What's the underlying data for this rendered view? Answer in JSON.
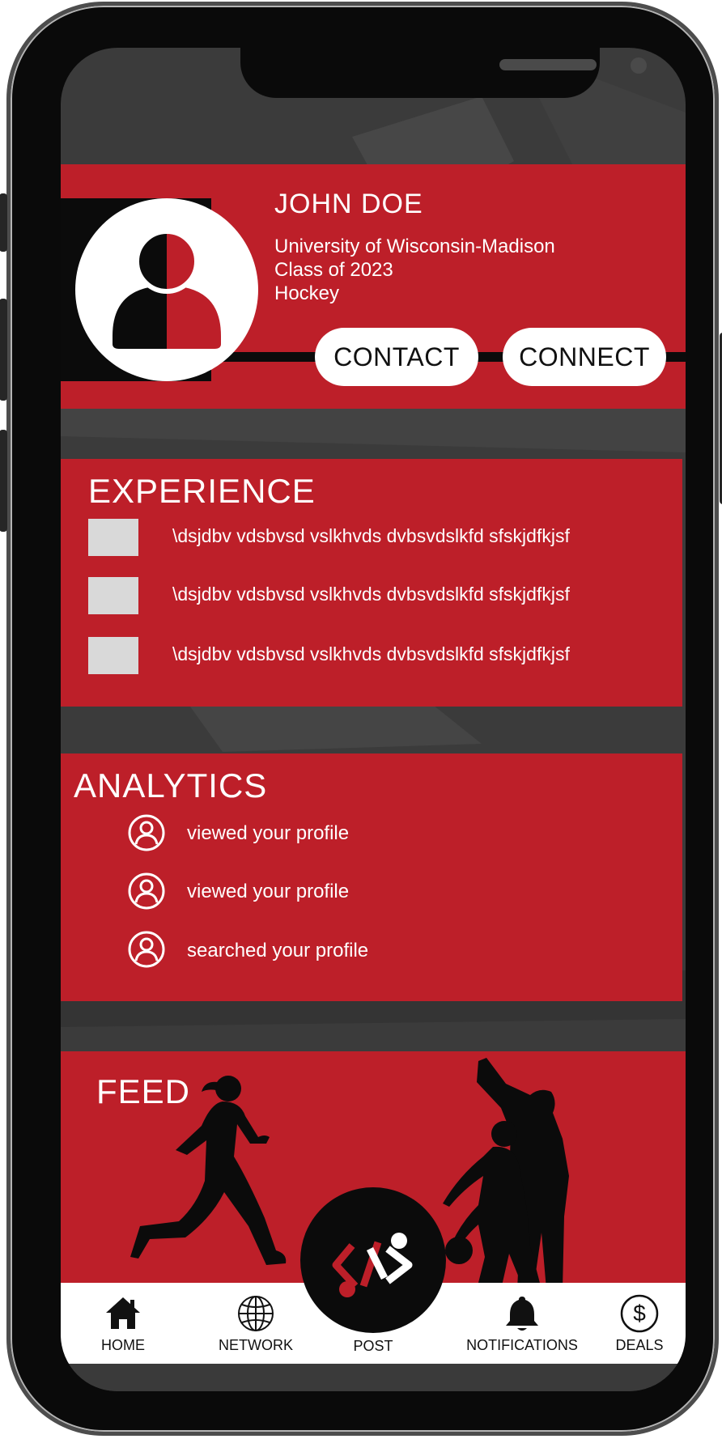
{
  "colors": {
    "accent_red": "#bd1f29",
    "dark": "#0b0b0b",
    "background": "#3b3b3b",
    "tab_background": "#ffffff"
  },
  "profile": {
    "name": "JOHN DOE",
    "school": "University of Wisconsin-Madison",
    "class_year": "Class of 2023",
    "sport": "Hockey",
    "avatar_icon": "person-icon",
    "contact_label": "CONTACT",
    "connect_label": "CONNECT"
  },
  "experience": {
    "title": "EXPERIENCE",
    "items": [
      {
        "text": "\\dsjdbv vdsbvsd vslkhvds dvbsvdslkfd sfskjdfkjsf"
      },
      {
        "text": "\\dsjdbv vdsbvsd vslkhvds dvbsvdslkfd sfskjdfkjsf"
      },
      {
        "text": "\\dsjdbv vdsbvsd vslkhvds dvbsvdslkfd sfskjdfkjsf"
      }
    ]
  },
  "analytics": {
    "title": "ANALYTICS",
    "items": [
      {
        "icon": "user-circle-icon",
        "text": "viewed your profile"
      },
      {
        "icon": "user-circle-icon",
        "text": "viewed your profile"
      },
      {
        "icon": "user-circle-icon",
        "text": "searched your profile"
      }
    ]
  },
  "feed": {
    "title": "FEED"
  },
  "tabbar": {
    "home": {
      "label": "HOME",
      "icon": "home-icon"
    },
    "network": {
      "label": "NETWORK",
      "icon": "globe-icon"
    },
    "post": {
      "label": "POST",
      "icon": "app-logo-icon"
    },
    "notifications": {
      "label": "NOTIFICATIONS",
      "icon": "bell-icon"
    },
    "deals": {
      "label": "DEALS",
      "icon": "dollar-icon"
    }
  }
}
